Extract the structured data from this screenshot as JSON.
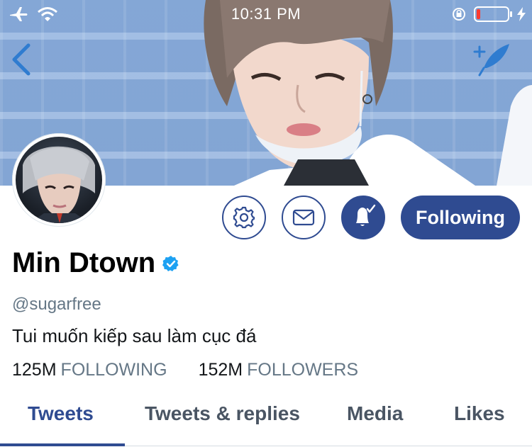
{
  "status_bar": {
    "time": "10:31 PM",
    "icons": [
      "airplane-icon",
      "wifi-icon",
      "orientation-lock-icon",
      "battery-icon",
      "charging-icon"
    ],
    "battery_level": 0.12,
    "battery_color": "#ff3b30"
  },
  "nav": {
    "back_icon": "chevron-left-icon",
    "compose_icon": "compose-tweet-icon"
  },
  "profile": {
    "name": "Min Dtown",
    "verified": true,
    "handle": "@sugarfree",
    "bio": "Tui muốn kiếp sau làm cục đá",
    "following_count": "125M",
    "following_label": "FOLLOWING",
    "followers_count": "152M",
    "followers_label": "FOLLOWERS"
  },
  "actions": {
    "settings_icon": "gear-icon",
    "message_icon": "envelope-icon",
    "notify_icon": "bell-check-icon",
    "follow_label": "Following"
  },
  "tabs": [
    {
      "label": "Tweets",
      "active": true
    },
    {
      "label": "Tweets & replies",
      "active": false
    },
    {
      "label": "Media",
      "active": false
    },
    {
      "label": "Likes",
      "active": false
    }
  ],
  "colors": {
    "accent": "#2f4b91",
    "verified": "#1da1f2",
    "muted_text": "#657786",
    "tab_inactive": "#4a5563"
  }
}
